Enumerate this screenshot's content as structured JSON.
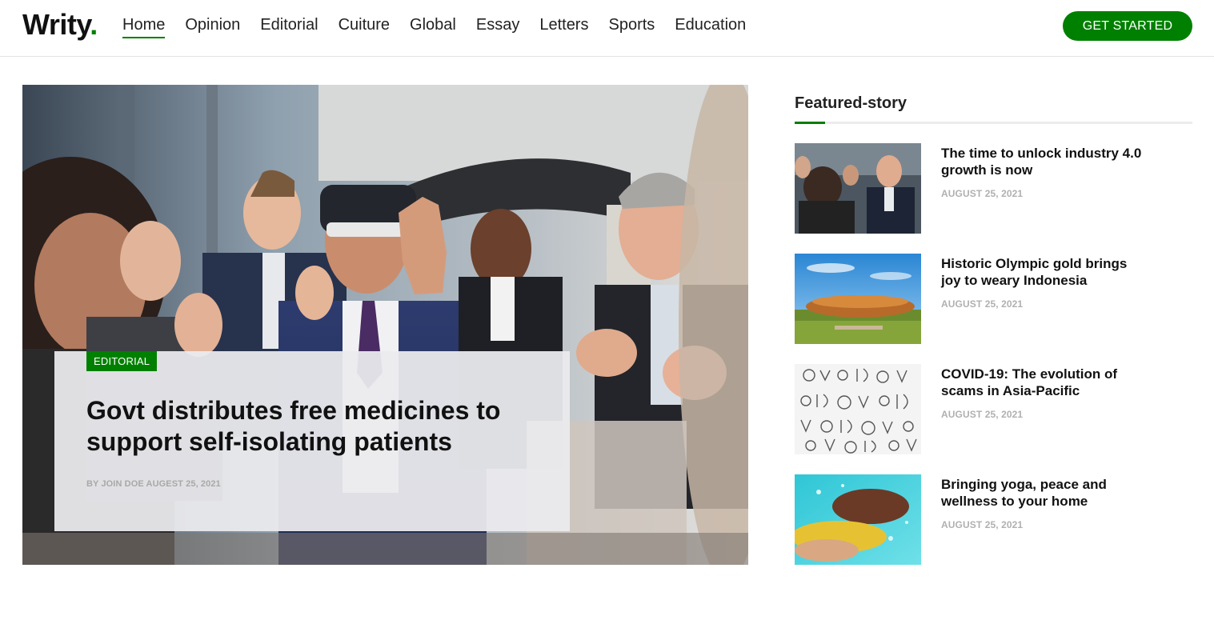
{
  "header": {
    "logo_text": "Writy",
    "logo_dot": ".",
    "nav": [
      {
        "label": "Home",
        "active": true
      },
      {
        "label": "Opinion"
      },
      {
        "label": "Editorial"
      },
      {
        "label": "Cuiture"
      },
      {
        "label": "Global"
      },
      {
        "label": "Essay"
      },
      {
        "label": "Letters"
      },
      {
        "label": "Sports"
      },
      {
        "label": "Education"
      }
    ],
    "cta_label": "GET STARTED"
  },
  "hero": {
    "tag": "EDITORIAL",
    "title": "Govt distributes free medicines to support self-isolating patients",
    "meta": "BY JOIN DOE AUGEST 25, 2021"
  },
  "featured": {
    "heading": "Featured-story",
    "stories": [
      {
        "title": "The time to unlock industry 4.0 growth is now",
        "date": "AUGUST 25, 2021",
        "thumb": "press-conference-photo"
      },
      {
        "title": "Historic Olympic gold brings joy to weary Indonesia",
        "date": "AUGUST 25, 2021",
        "thumb": "stadium-photo"
      },
      {
        "title": "COVID-19: The evolution of scams in Asia-Pacific",
        "date": "AUGUST 25, 2021",
        "thumb": "covid-text-pattern"
      },
      {
        "title": "Bringing yoga, peace and wellness to your home",
        "date": "AUGUST 25, 2021",
        "thumb": "swimmer-photo"
      }
    ]
  },
  "colors": {
    "accent": "#008000",
    "date_gray": "#b0b0b0",
    "meta_gray": "#a8a8a8"
  }
}
